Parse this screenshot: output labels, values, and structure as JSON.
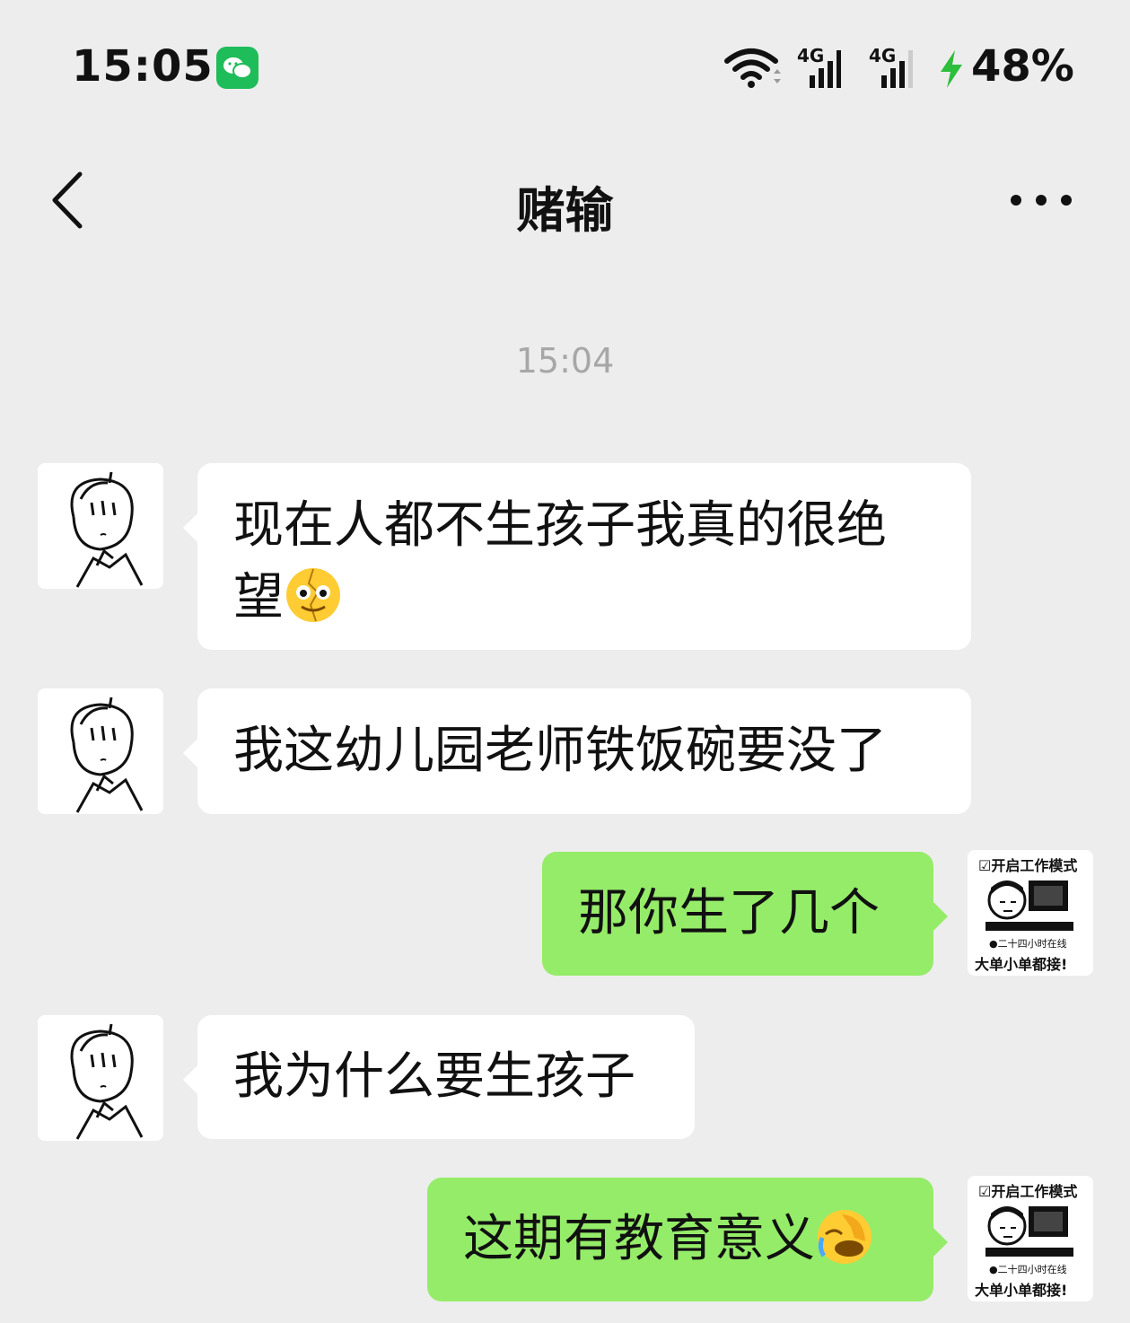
{
  "status_bar": {
    "time": "15:05",
    "network_1": "4G",
    "network_2": "4G",
    "battery": "48%"
  },
  "header": {
    "title": "赌输"
  },
  "timestamp": "15:04",
  "messages": [
    {
      "side": "left",
      "line1": "现在人都不生孩子我真的很绝",
      "line2": "望"
    },
    {
      "side": "left",
      "text": "我这幼儿园老师铁饭碗要没了"
    },
    {
      "side": "right",
      "text": "那你生了几个"
    },
    {
      "side": "left",
      "text": "我为什么要生孩子"
    },
    {
      "side": "right",
      "text": "这期有教育意义"
    }
  ],
  "my_avatar": {
    "top_text": "☑开启工作模式",
    "mid_text": "●二十四小时在线",
    "bottom_text": "大单小单都接!"
  },
  "colors": {
    "background": "#ededed",
    "bubble_self": "#95ec69",
    "bubble_other": "#ffffff",
    "wechat_green": "#1fbd5a"
  }
}
